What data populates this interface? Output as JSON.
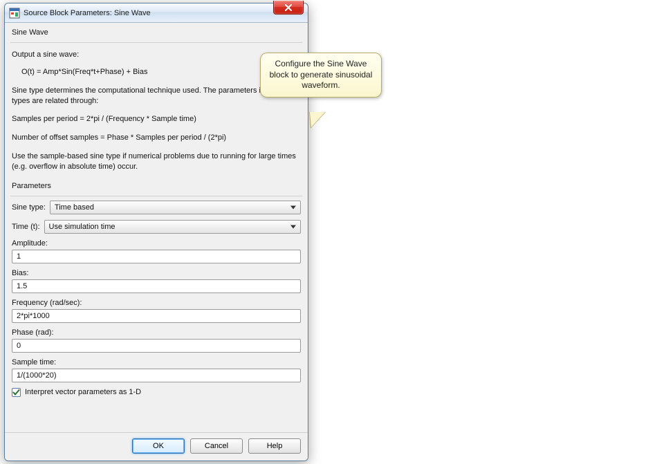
{
  "window": {
    "title": "Source Block Parameters: Sine Wave"
  },
  "header": {
    "block_name": "Sine Wave"
  },
  "description": {
    "line1": "Output a sine wave:",
    "formula": "O(t) = Amp*Sin(Freq*t+Phase) + Bias",
    "line2": "Sine type determines the computational technique used. The parameters in the two types are related through:",
    "line3": "Samples per period = 2*pi / (Frequency * Sample time)",
    "line4": "Number of offset samples = Phase * Samples per period / (2*pi)",
    "line5": "Use the sample-based sine type if numerical problems due to running for large times (e.g. overflow in absolute time) occur."
  },
  "parameters": {
    "section_label": "Parameters",
    "sine_type_label": "Sine type:",
    "sine_type_value": "Time based",
    "time_label": "Time (t):",
    "time_value": "Use simulation time",
    "amplitude_label": "Amplitude:",
    "amplitude_value": "1",
    "bias_label": "Bias:",
    "bias_value": "1.5",
    "frequency_label": "Frequency (rad/sec):",
    "frequency_value": "2*pi*1000",
    "phase_label": "Phase (rad):",
    "phase_value": "0",
    "sample_time_label": "Sample time:",
    "sample_time_value": "1/(1000*20)",
    "vector_1d_label": "Interpret vector parameters as 1-D",
    "vector_1d_checked": true
  },
  "buttons": {
    "ok": "OK",
    "cancel": "Cancel",
    "help": "Help"
  },
  "tooltip": {
    "text": "Configure the Sine Wave block to generate sinusoidal waveform."
  }
}
